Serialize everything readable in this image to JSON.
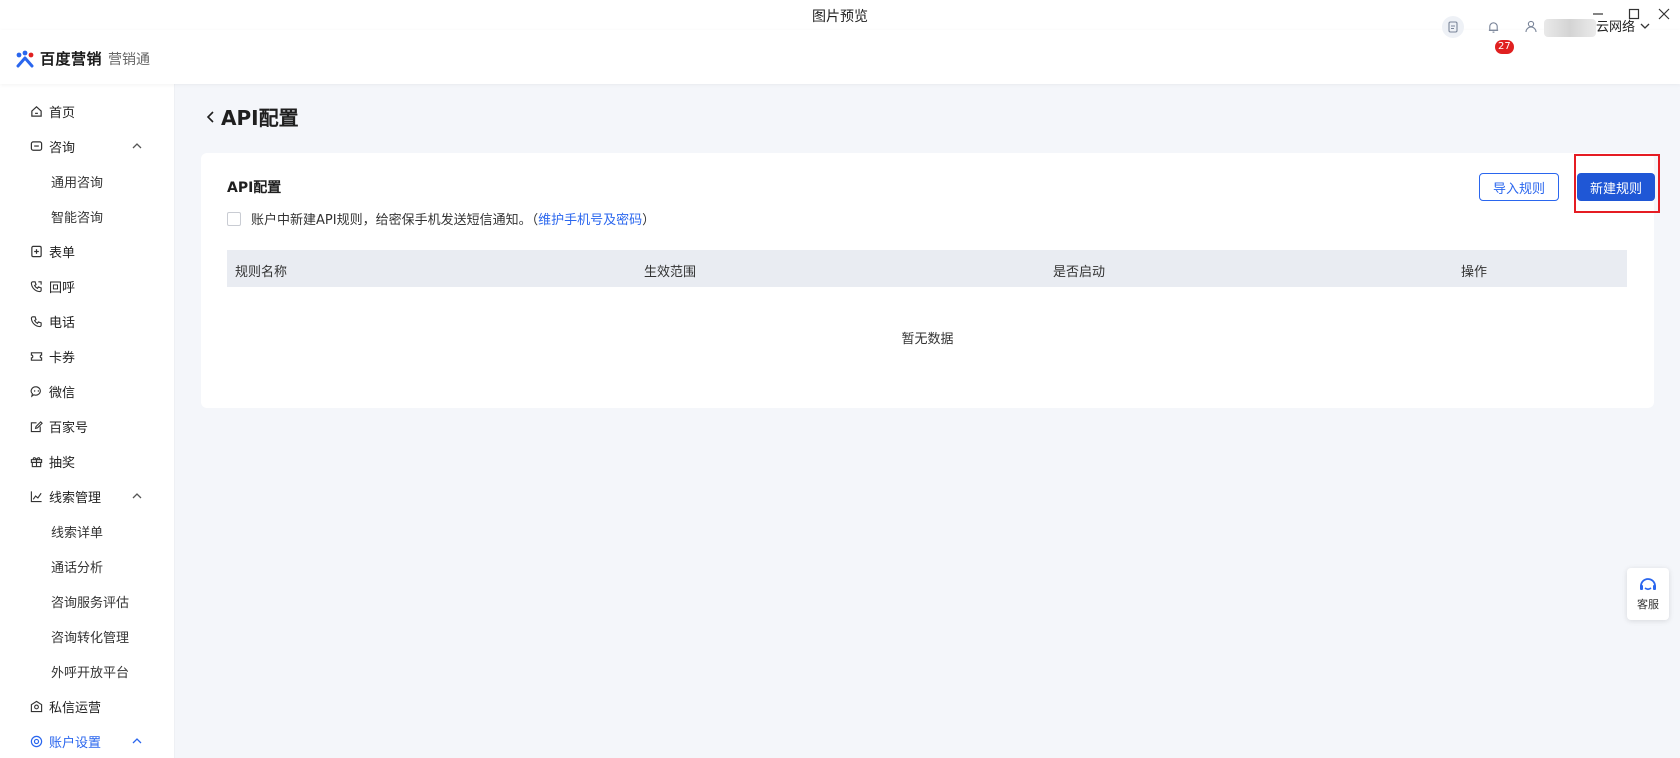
{
  "window": {
    "title": "图片预览",
    "minimize": "—",
    "maximize": "☐",
    "close": "✕"
  },
  "header": {
    "brand": "百度营销",
    "product": "营销通",
    "notification_count": "27",
    "user_name_suffix": "云网络"
  },
  "sidebar": {
    "items": [
      {
        "label": "首页",
        "icon": "home-icon"
      },
      {
        "label": "咨询",
        "icon": "chat-icon",
        "expanded": true
      },
      {
        "label": "通用咨询"
      },
      {
        "label": "智能咨询"
      },
      {
        "label": "表单",
        "icon": "form-icon"
      },
      {
        "label": "回呼",
        "icon": "callback-icon"
      },
      {
        "label": "电话",
        "icon": "phone-icon"
      },
      {
        "label": "卡券",
        "icon": "coupon-icon"
      },
      {
        "label": "微信",
        "icon": "wechat-icon"
      },
      {
        "label": "百家号",
        "icon": "edit-icon"
      },
      {
        "label": "抽奖",
        "icon": "gift-icon"
      },
      {
        "label": "线索管理",
        "icon": "chart-icon",
        "expanded": true
      },
      {
        "label": "线索详单"
      },
      {
        "label": "通话分析"
      },
      {
        "label": "咨询服务评估"
      },
      {
        "label": "咨询转化管理"
      },
      {
        "label": "外呼开放平台"
      },
      {
        "label": "私信运营",
        "icon": "message-icon"
      },
      {
        "label": "账户设置",
        "icon": "settings-icon",
        "expanded": true,
        "active": true
      }
    ]
  },
  "page": {
    "back": "<",
    "title": "API配置"
  },
  "card": {
    "title": "API配置",
    "notice_text": "账户中新建API规则，给密保手机发送短信通知。（",
    "notice_link": "维护手机号及密码",
    "notice_end": "）",
    "import_button": "导入规则",
    "new_button": "新建规则",
    "columns": [
      "规则名称",
      "生效范围",
      "是否启动",
      "操作"
    ],
    "empty_text": "暂无数据"
  },
  "customer_service": {
    "label": "客服"
  },
  "colors": {
    "accent": "#2a66ee",
    "primary_button": "#1f57d6",
    "highlight_box": "#e51c23",
    "badge": "#e02020",
    "background": "#f4f6fa"
  }
}
